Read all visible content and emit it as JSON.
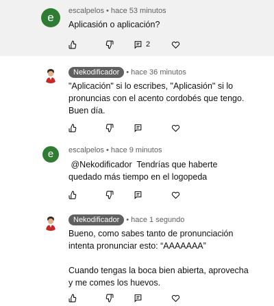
{
  "comments": [
    {
      "avatar_letter": "e",
      "avatar_color": "#2e7d32",
      "author": "escalpelos",
      "time": "hace 53 minutos",
      "text": "Aplicasión o aplicación?",
      "reply_count": "2",
      "highlighted": true
    },
    {
      "author": "Nekodificador",
      "author_badge": true,
      "time": "hace 36 minutos",
      "text": "\"Aplicación\" si lo escribes, \"Aplicasión\" si lo pronuncias con el acento cordobés que tengo. Buen día."
    },
    {
      "avatar_letter": "e",
      "avatar_color": "#2e7d32",
      "author": "escalpelos",
      "time": "hace 9 minutos",
      "text": " @Nekodificador  Tendrías que haberte quedado más tiempo en el logopeda"
    },
    {
      "author": "Nekodificador",
      "author_badge": true,
      "time": "hace 1 segundo",
      "text": "Bueno, como sabes tanto de pronunciación intenta pronunciar esto: “AAAAAAA”\n\nCuando tengas la boca bien abierta, aprovecha y me comes los huevos."
    }
  ],
  "icons": {
    "like": "thumbs-up-icon",
    "dislike": "thumbs-down-icon",
    "reply": "comment-icon",
    "heart": "heart-icon",
    "more": "more-vertical-icon"
  }
}
